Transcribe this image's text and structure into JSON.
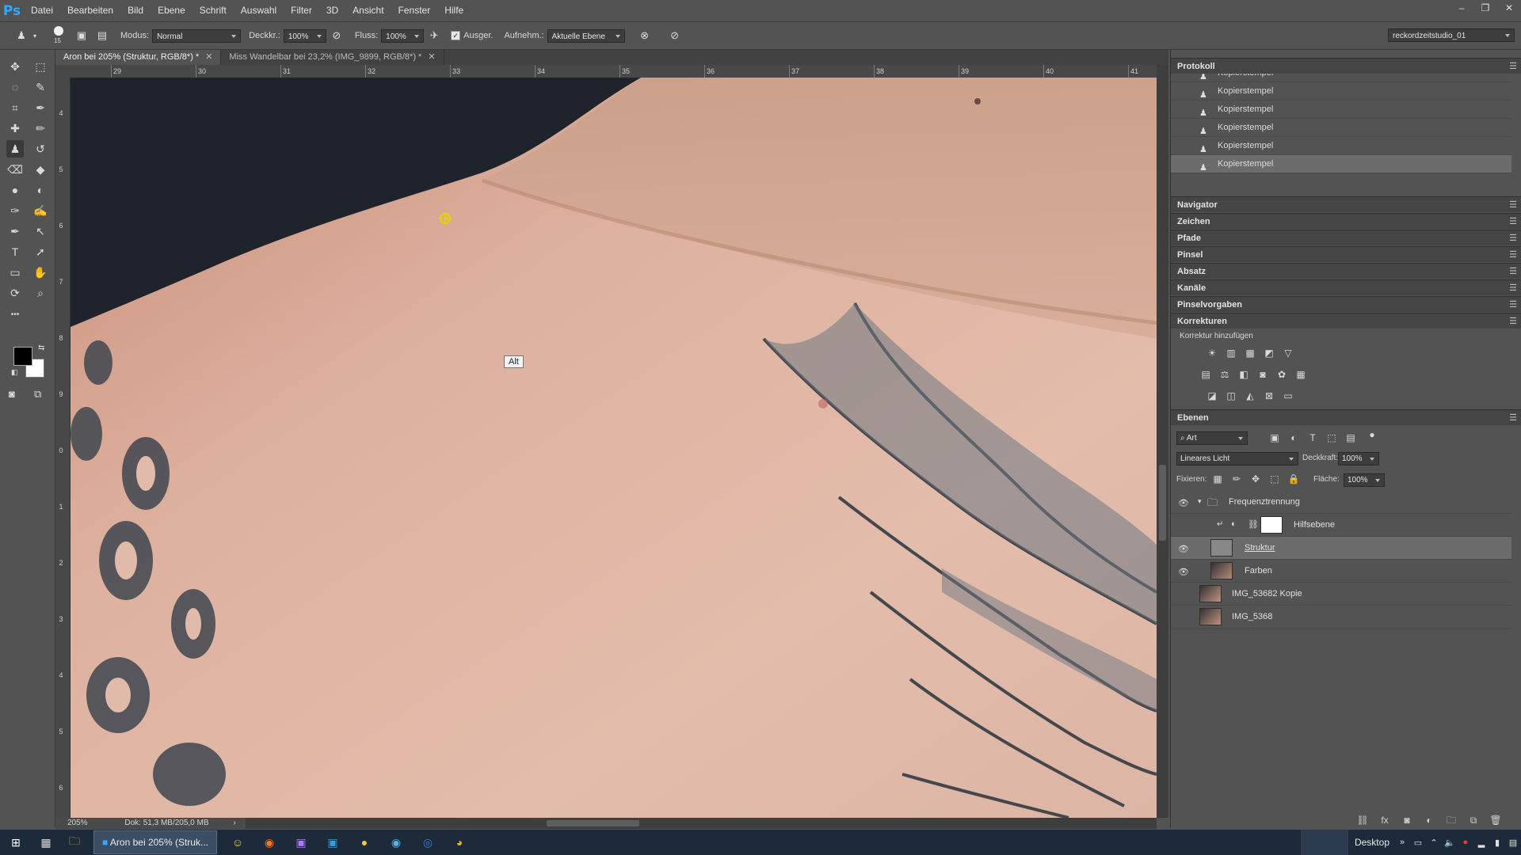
{
  "app": {
    "logo": "Ps",
    "menu": [
      "Datei",
      "Bearbeiten",
      "Bild",
      "Ebene",
      "Schrift",
      "Auswahl",
      "Filter",
      "3D",
      "Ansicht",
      "Fenster",
      "Hilfe"
    ],
    "window_controls": [
      "–",
      "❐",
      "✕"
    ]
  },
  "options": {
    "brush_size": "15",
    "mode_label": "Modus:",
    "mode_value": "Normal",
    "opacity_label": "Deckkr.:",
    "opacity_value": "100%",
    "flow_label": "Fluss:",
    "flow_value": "100%",
    "aligned_label": "Ausger.",
    "aligned_checked": "✓",
    "sample_label": "Aufnehm.:",
    "sample_value": "Aktuelle Ebene",
    "workspace": "reckordzeitstudio_01"
  },
  "tools": [
    {
      "name": "move-tool",
      "icon": "✥"
    },
    {
      "name": "marquee-tool",
      "icon": "⬚"
    },
    {
      "name": "lasso-tool",
      "icon": "◌"
    },
    {
      "name": "quick-select-tool",
      "icon": "✎"
    },
    {
      "name": "crop-tool",
      "icon": "⌗"
    },
    {
      "name": "eyedropper-tool",
      "icon": "✒"
    },
    {
      "name": "healing-brush-tool",
      "icon": "✚"
    },
    {
      "name": "brush-tool",
      "icon": "✏"
    },
    {
      "name": "clone-stamp-tool",
      "icon": "♟"
    },
    {
      "name": "history-brush-tool",
      "icon": "↺"
    },
    {
      "name": "eraser-tool",
      "icon": "⌫"
    },
    {
      "name": "paint-bucket-tool",
      "icon": "◆"
    },
    {
      "name": "blur-tool",
      "icon": "●"
    },
    {
      "name": "dodge-tool",
      "icon": "◐"
    },
    {
      "name": "pen-tool",
      "icon": "✑"
    },
    {
      "name": "freeform-pen-tool",
      "icon": "✍"
    },
    {
      "name": "pen-tool-2",
      "icon": "✒"
    },
    {
      "name": "path-select-tool",
      "icon": "↖"
    },
    {
      "name": "type-tool",
      "icon": "T"
    },
    {
      "name": "direct-select-tool",
      "icon": "➚"
    },
    {
      "name": "rectangle-tool",
      "icon": "▭"
    },
    {
      "name": "hand-tool",
      "icon": "✋"
    },
    {
      "name": "rotate-view-tool",
      "icon": "⟳"
    },
    {
      "name": "zoom-tool",
      "icon": "⌕"
    }
  ],
  "extra_tools": "•••",
  "tabs": [
    {
      "label": "Aron bei 205% (Struktur, RGB/8*) *"
    },
    {
      "label": "Miss Wandelbar bei 23,2% (IMG_9899, RGB/8*) *"
    }
  ],
  "ruler": {
    "h": [
      "29",
      "30",
      "31",
      "32",
      "33",
      "34",
      "35",
      "36",
      "37",
      "38",
      "39",
      "40",
      "41"
    ],
    "v": [
      "4",
      "5",
      "6",
      "7",
      "8",
      "9",
      "0",
      "1",
      "2",
      "3",
      "4",
      "5",
      "6"
    ]
  },
  "canvas": {
    "tooltip": "Alt"
  },
  "status": {
    "zoom": "205%",
    "doc": "Dok: 51,3 MB/205,0 MB"
  },
  "panels": {
    "history_title": "Protokoll",
    "history_items": [
      "Kopierstempel",
      "Kopierstempel",
      "Kopierstempel",
      "Kopierstempel",
      "Kopierstempel",
      "Kopierstempel"
    ],
    "collapsed": [
      "Navigator",
      "Zeichen",
      "Pfade",
      "Pinsel",
      "Absatz",
      "Kanäle",
      "Pinselvorgaben"
    ],
    "corrections_title": "Korrekturen",
    "corrections_sub": "Korrektur hinzufügen",
    "layers_title": "Ebenen",
    "filter_kind": "Art",
    "blend_mode": "Lineares Licht",
    "opacity_label": "Deckkraft:",
    "opacity_value": "100%",
    "lock_label": "Fixieren:",
    "fill_label": "Fläche:",
    "fill_value": "100%",
    "layers": [
      {
        "name": "Frequenztrennung",
        "type": "group"
      },
      {
        "name": "Hilfsebene",
        "type": "adjustment"
      },
      {
        "name": "Struktur",
        "type": "layer"
      },
      {
        "name": "Farben",
        "type": "layer"
      },
      {
        "name": "IMG_53682 Kopie",
        "type": "layer"
      },
      {
        "name": "IMG_5368",
        "type": "layer"
      }
    ]
  },
  "taskbar": {
    "active_app": "Aron bei 205% (Struk...",
    "desktop": "Desktop"
  }
}
